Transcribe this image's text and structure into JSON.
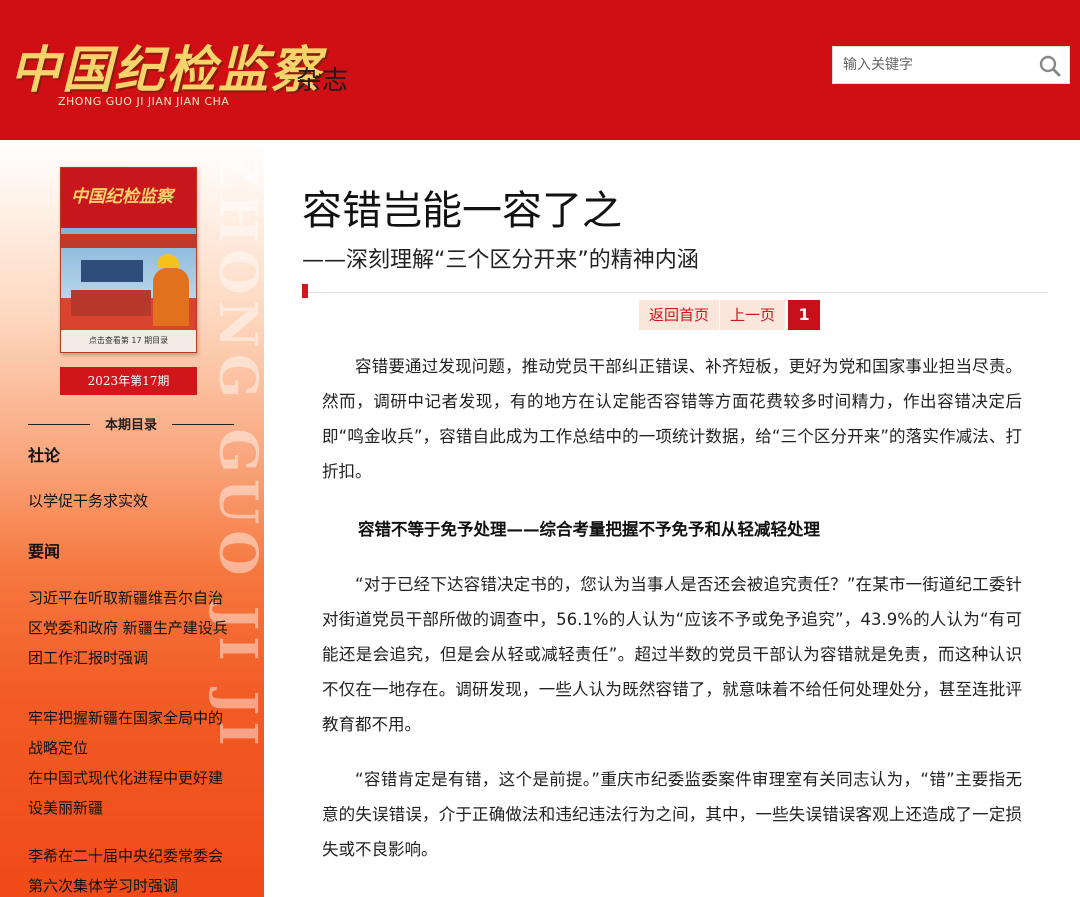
{
  "header": {
    "logo_title": "中国纪检监察",
    "logo_suffix": "杂志",
    "logo_pinyin": "ZHONG GUO JI JIAN JIAN CHA",
    "search_placeholder": "输入关键字",
    "brand_color": "#cf0f14",
    "logo_color": "#f6d36b"
  },
  "sidebar": {
    "watermark": "ZHONG GUO JI JI",
    "cover": {
      "title": "中国纪检监察",
      "caption": "点击查看第 17 期目录"
    },
    "issue_label": "2023年第17期",
    "toc_heading": "本期目录",
    "sections": [
      {
        "name": "社论",
        "links": [
          "以学促干务求实效"
        ]
      },
      {
        "name": "要闻",
        "links": [
          "习近平在听取新疆维吾尔自治区党委和政府 新疆生产建设兵团工作汇报时强调",
          "牢牢把握新疆在国家全局中的战略定位",
          "在中国式现代化进程中更好建设美丽新疆",
          "李希在二十届中央纪委常委会第六次集体学习时强调"
        ]
      }
    ]
  },
  "article": {
    "title": "容错岂能一容了之",
    "subtitle": "——深刻理解“三个区分开来”的精神内涵",
    "pager": {
      "home": "返回首页",
      "prev": "上一页",
      "current": "1"
    },
    "paragraphs": [
      "容错要通过发现问题，推动党员干部纠正错误、补齐短板，更好为党和国家事业担当尽责。然而，调研中记者发现，有的地方在认定能否容错等方面花费较多时间精力，作出容错决定后即“鸣金收兵”，容错自此成为工作总结中的一项统计数据，给“三个区分开来”的落实作减法、打折扣。",
      "容错不等于免予处理——综合考量把握不予免予和从轻减轻处理",
      "“对于已经下达容错决定书的，您认为当事人是否还会被追究责任？”在某市一街道纪工委针对街道党员干部所做的调查中，56.1%的人认为“应该不予或免予追究”，43.9%的人认为“有可能还是会追究，但是会从轻或减轻责任”。超过半数的党员干部认为容错就是免责，而这种认识不仅在一地存在。调研发现，一些人认为既然容错了，就意味着不给任何处理处分，甚至连批评教育都不用。",
      "“容错肯定是有错，这个是前提。”重庆市纪委监委案件审理室有关同志认为，“错”主要指无意的失误错误，介于正确做法和违纪违法行为之间，其中，一些失误错误客观上还造成了一定损失或不良影响。"
    ]
  }
}
